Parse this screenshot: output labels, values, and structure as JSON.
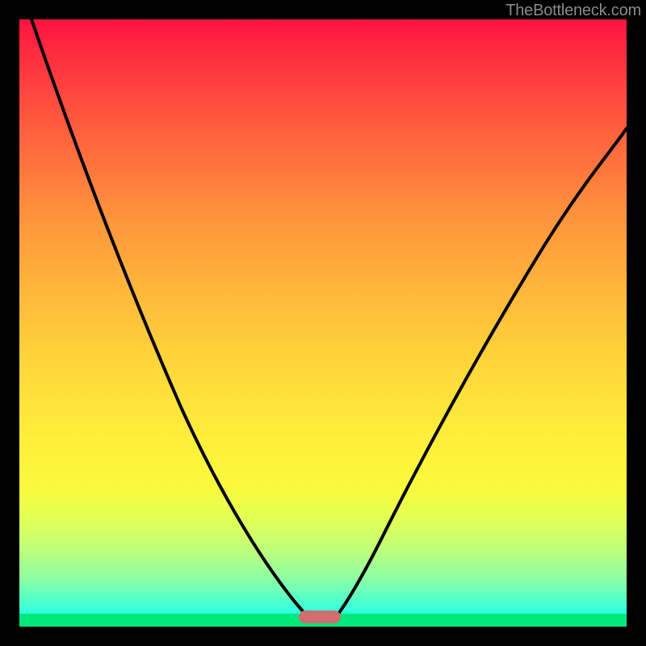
{
  "watermark": "TheBottleneck.com",
  "chart_data": {
    "type": "line",
    "title": "",
    "xlabel": "",
    "ylabel": "",
    "xlim": [
      0,
      100
    ],
    "ylim": [
      0,
      100
    ],
    "series": [
      {
        "name": "left-curve",
        "x": [
          2,
          8,
          14,
          20,
          26,
          32,
          36,
          40,
          43,
          45,
          46.5,
          47.5
        ],
        "values": [
          100,
          85,
          71,
          58,
          44,
          31,
          22,
          14,
          8,
          4,
          1.5,
          0
        ]
      },
      {
        "name": "right-curve",
        "x": [
          52,
          54,
          57,
          61,
          66,
          72,
          79,
          87,
          95,
          100
        ],
        "values": [
          0,
          2,
          6,
          12,
          22,
          34,
          48,
          62,
          75,
          82
        ]
      }
    ],
    "marker": {
      "x_start": 46,
      "x_end": 53,
      "y": 0
    },
    "gradient_stops": [
      {
        "pos": 0,
        "color": "#ff133f"
      },
      {
        "pos": 100,
        "color": "#2cffe3"
      }
    ]
  }
}
